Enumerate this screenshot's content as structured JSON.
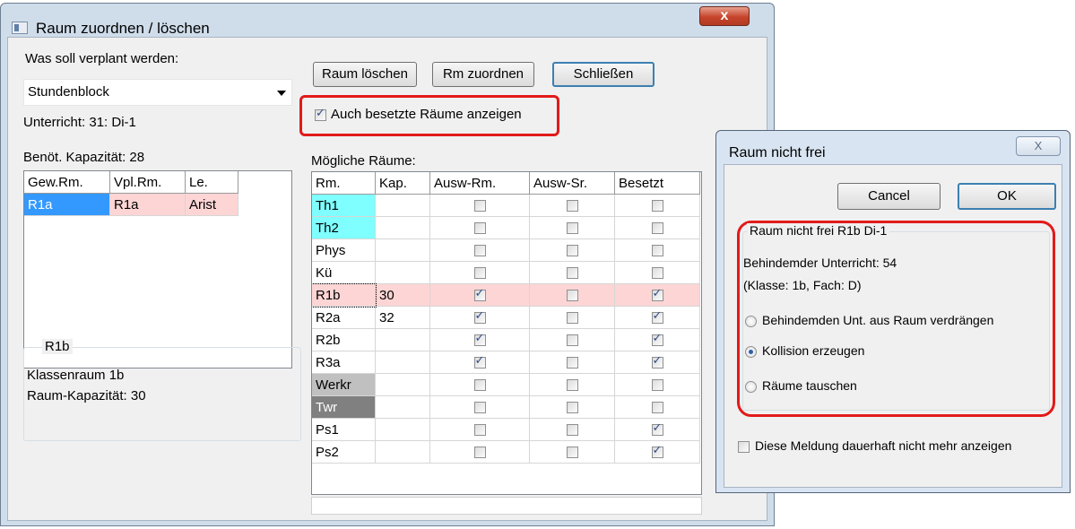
{
  "main_window": {
    "title": "Raum zuordnen / löschen",
    "close_symbol": "x",
    "plan_label": "Was soll verplant werden:",
    "plan_value": "Stundenblock",
    "lesson_info": "Unterricht: 31: Di-1",
    "capacity_needed": "Benöt. Kapazität: 28",
    "buttons": {
      "delete_room": "Raum löschen",
      "assign_room": "Rm zuordnen",
      "close": "Schließen"
    },
    "show_occupied_label": "Auch besetzte Räume anzeigen",
    "show_occupied_checked": true,
    "possible_rooms_label": "Mögliche Räume:",
    "assigned_table": {
      "headers": [
        "Gew.Rm.",
        "Vpl.Rm.",
        "Le."
      ],
      "rows": [
        [
          "R1a",
          "R1a",
          "Arist"
        ]
      ]
    },
    "room_info": {
      "title": "R1b",
      "line1": "Klassenraum 1b",
      "line2": "Raum-Kapazität: 30"
    },
    "rooms_table": {
      "headers": [
        "Rm.",
        "Kap.",
        "Ausw-Rm.",
        "Ausw-Sr.",
        "Besetzt"
      ],
      "rows": [
        {
          "room": "Th1",
          "cap": "",
          "ausw_rm": false,
          "ausw_sr": false,
          "besetzt": false
        },
        {
          "room": "Th2",
          "cap": "",
          "ausw_rm": false,
          "ausw_sr": false,
          "besetzt": false
        },
        {
          "room": "Phys",
          "cap": "",
          "ausw_rm": false,
          "ausw_sr": false,
          "besetzt": false
        },
        {
          "room": "Kü",
          "cap": "",
          "ausw_rm": false,
          "ausw_sr": false,
          "besetzt": false
        },
        {
          "room": "R1b",
          "cap": "30",
          "ausw_rm": true,
          "ausw_sr": false,
          "besetzt": true
        },
        {
          "room": "R2a",
          "cap": "32",
          "ausw_rm": true,
          "ausw_sr": false,
          "besetzt": true
        },
        {
          "room": "R2b",
          "cap": "",
          "ausw_rm": true,
          "ausw_sr": false,
          "besetzt": true
        },
        {
          "room": "R3a",
          "cap": "",
          "ausw_rm": true,
          "ausw_sr": false,
          "besetzt": true
        },
        {
          "room": "Werkr",
          "cap": "",
          "ausw_rm": false,
          "ausw_sr": false,
          "besetzt": false
        },
        {
          "room": "Twr",
          "cap": "",
          "ausw_rm": false,
          "ausw_sr": false,
          "besetzt": false
        },
        {
          "room": "Ps1",
          "cap": "",
          "ausw_rm": false,
          "ausw_sr": false,
          "besetzt": true
        },
        {
          "room": "Ps2",
          "cap": "",
          "ausw_rm": false,
          "ausw_sr": false,
          "besetzt": true
        }
      ]
    }
  },
  "dialog": {
    "title": "Raum nicht frei",
    "close_symbol": "X",
    "cancel_label": "Cancel",
    "ok_label": "OK",
    "group_title": "Raum nicht frei  R1b  Di-1",
    "blocking_lesson": "Behindemder Unterricht: 54",
    "class_subject": "(Klasse: 1b, Fach: D)",
    "options": [
      {
        "label": "Behindemden Unt. aus Raum verdrängen",
        "selected": false
      },
      {
        "label": "Kollision erzeugen",
        "selected": true
      },
      {
        "label": "Räume tauschen",
        "selected": false
      }
    ],
    "dont_show_label": "Diese Meldung dauerhaft nicht mehr anzeigen",
    "dont_show_checked": false
  },
  "colors": {
    "highlight_red": "#e21a1a",
    "selection_blue": "#3399ff",
    "row_pink": "#fdd5d5",
    "room_cyan": "#7fffff",
    "room_gray": "#c0c0c0",
    "room_darkgray": "#808080"
  }
}
